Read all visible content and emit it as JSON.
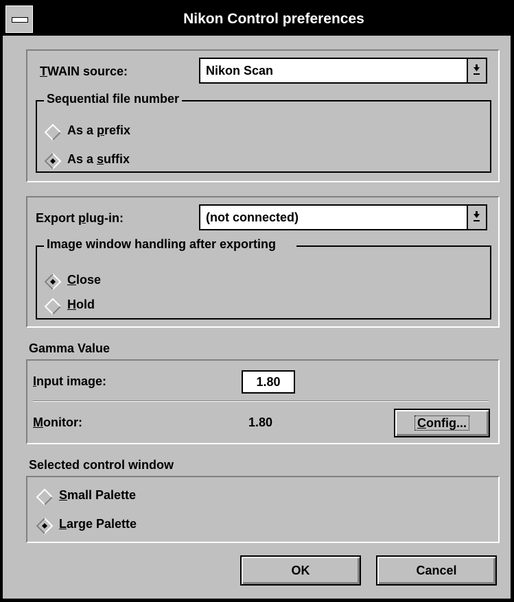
{
  "window": {
    "title": "Nikon Control preferences"
  },
  "twain": {
    "label_u": "T",
    "label_rest": "WAIN source:",
    "value": "Nikon Scan",
    "group_title": "Sequential file number",
    "prefix": {
      "pre": "As a ",
      "u": "p",
      "post": "refix",
      "selected": false
    },
    "suffix": {
      "pre": "As a ",
      "u": "s",
      "post": "uffix",
      "selected": true
    }
  },
  "export": {
    "label_pre": "Export ",
    "label_u": "p",
    "label_rest": "lug-in:",
    "value": "(not connected)",
    "group_title": "Image window handling after exporting",
    "close": {
      "u": "C",
      "rest": "lose",
      "selected": true
    },
    "hold": {
      "u": "H",
      "rest": "old",
      "selected": false
    }
  },
  "gamma": {
    "title": "Gamma Value",
    "input_label_u": "I",
    "input_label_rest": "nput image:",
    "input_value": "1.80",
    "monitor_label_u": "M",
    "monitor_label_rest": "onitor:",
    "monitor_value": "1.80",
    "config_u": "C",
    "config_rest": "onfig..."
  },
  "control_window": {
    "title": "Selected control window",
    "small": {
      "u": "S",
      "rest": "mall Palette",
      "selected": false
    },
    "large": {
      "u": "L",
      "rest": "arge Palette",
      "selected": true
    }
  },
  "buttons": {
    "ok": "OK",
    "cancel": "Cancel"
  }
}
